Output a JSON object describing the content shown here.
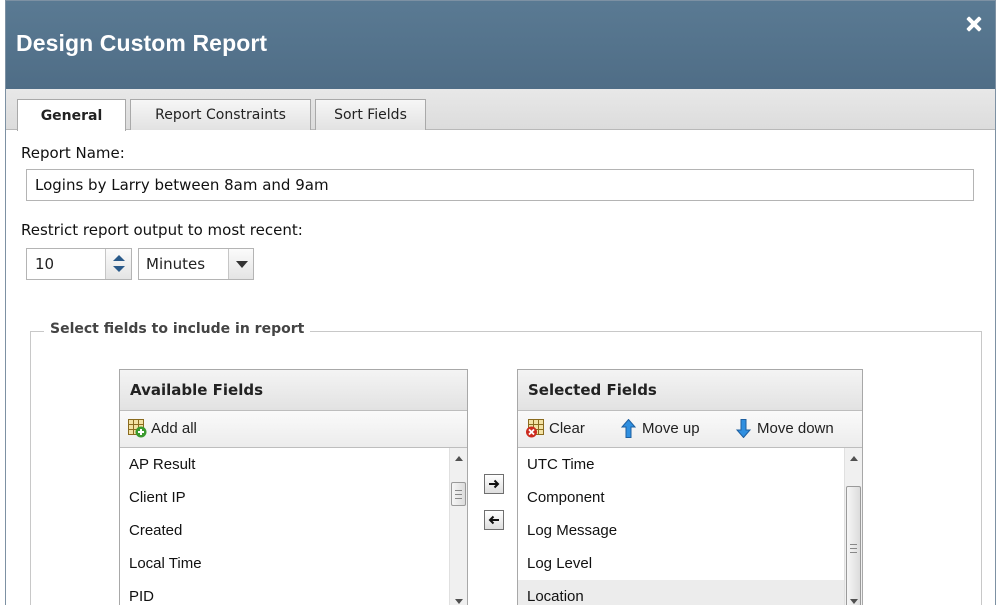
{
  "dialog": {
    "title": "Design Custom Report",
    "close_icon": "close-icon"
  },
  "tabs": [
    {
      "label": "General",
      "active": true
    },
    {
      "label": "Report Constraints",
      "active": false
    },
    {
      "label": "Sort Fields",
      "active": false
    }
  ],
  "form": {
    "report_name_label": "Report Name:",
    "report_name_value": "Logins by Larry between 8am and 9am",
    "restrict_label": "Restrict report output to most recent:",
    "restrict_value": "10",
    "unit_value": "Minutes"
  },
  "fieldset": {
    "legend": "Select fields to include in report"
  },
  "available": {
    "header": "Available Fields",
    "add_all_label": "Add all",
    "add_all_icon": "add-table-icon",
    "items": [
      "AP Result",
      "Client IP",
      "Created",
      "Local Time",
      "PID"
    ]
  },
  "selected": {
    "header": "Selected Fields",
    "clear_label": "Clear",
    "clear_icon": "clear-table-icon",
    "move_up_label": "Move up",
    "move_up_icon": "arrow-up-icon",
    "move_down_label": "Move down",
    "move_down_icon": "arrow-down-icon",
    "items": [
      "UTC Time",
      "Component",
      "Log Message",
      "Log Level",
      "Location"
    ],
    "highlighted_item": "Location"
  },
  "transfer": {
    "add_icon": "arrow-right-icon",
    "remove_icon": "arrow-left-icon"
  }
}
